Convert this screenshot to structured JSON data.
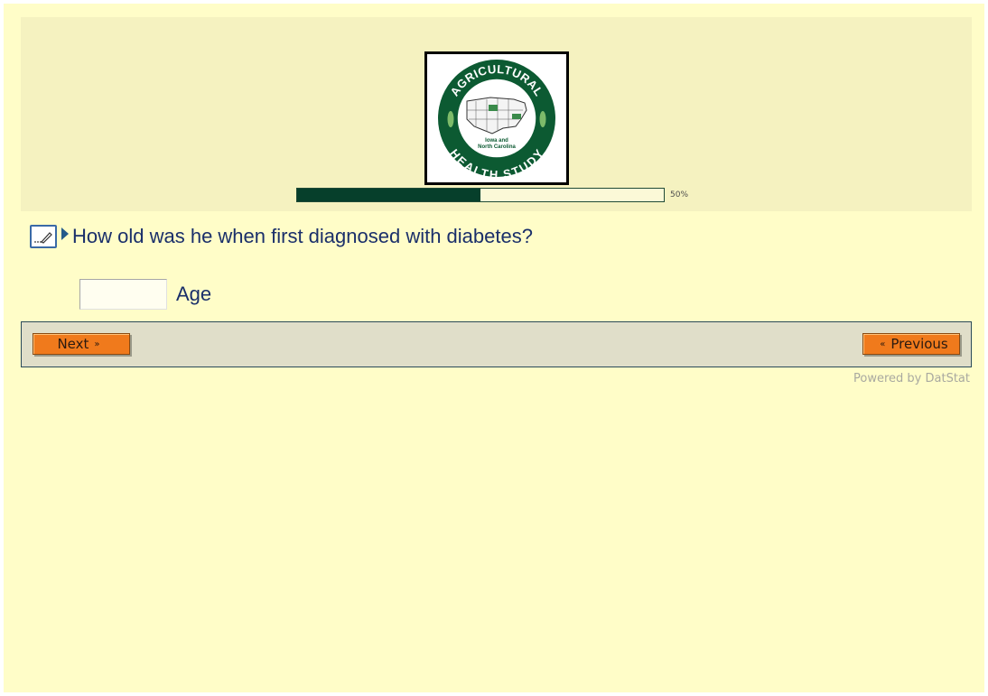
{
  "logo": {
    "arc_top": "AGRICULTURAL",
    "arc_bottom": "HEALTH STUDY",
    "center_line1": "Iowa and",
    "center_line2": "North Carolina"
  },
  "progress": {
    "percent": 50,
    "label": "50%"
  },
  "question": {
    "text": "How old was he when first diagnosed with diabetes?",
    "note_icon": "edit-note-icon",
    "arrow_icon": "triangle-right-icon"
  },
  "answer": {
    "value": "",
    "unit_label": "Age"
  },
  "nav": {
    "next_label": "Next",
    "next_glyph": "»",
    "previous_label": "Previous",
    "previous_glyph": "«"
  },
  "footer": {
    "powered_by": "Powered by DatStat"
  },
  "colors": {
    "page_bg": "#fffdc8",
    "accent_green": "#063f2b",
    "button_orange": "#f07a1c",
    "text_blue": "#1a2f6a"
  }
}
